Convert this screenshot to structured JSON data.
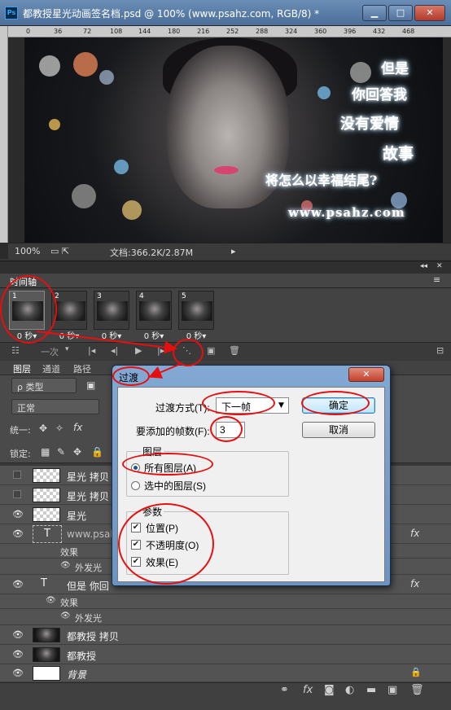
{
  "window": {
    "title": "都教授星光动画签名档.psd @ 100% (www.psahz.com, RGB/8) *",
    "ps_badge": "Ps",
    "min": "▁",
    "max": "□",
    "close": "✕"
  },
  "ruler": {
    "ticks": [
      "0",
      "36",
      "72",
      "108",
      "144",
      "180",
      "216",
      "252",
      "288",
      "324",
      "360",
      "396",
      "432",
      "468"
    ]
  },
  "canvas": {
    "poem": [
      "但是",
      "你回答我",
      "没有爱情",
      "故事",
      "将怎么以幸福结尾?"
    ],
    "watermark": "www.psahz.com"
  },
  "status": {
    "zoom": "100%",
    "doc": "文档:366.2K/2.87M"
  },
  "timeline": {
    "tab": "时间轴",
    "frames": [
      {
        "num": "1",
        "delay": "0 秒▾"
      },
      {
        "num": "2",
        "delay": "0 秒▾"
      },
      {
        "num": "3",
        "delay": "0 秒▾"
      },
      {
        "num": "4",
        "delay": "0 秒▾"
      },
      {
        "num": "5",
        "delay": "0 秒▾"
      }
    ],
    "loop": "一次"
  },
  "layers_panel": {
    "tabs": [
      "图层",
      "通道",
      "路径"
    ],
    "filter": "ρ 类型",
    "blend": "正常",
    "unify": "统一:",
    "lock": "锁定:",
    "rows": [
      {
        "name": "星光 拷贝",
        "visible": false,
        "thumb": "checker"
      },
      {
        "name": "星光 拷贝",
        "visible": false,
        "thumb": "checker"
      },
      {
        "name": "星光",
        "visible": true,
        "thumb": "checker"
      },
      {
        "name": "www.psah",
        "visible": true,
        "thumb": "text",
        "fx": "fx"
      },
      {
        "name": "效果",
        "sub": true
      },
      {
        "name": "外发光",
        "sub2": true
      },
      {
        "name": "但是 你回",
        "visible": true,
        "thumb": "text",
        "fx": "fx"
      },
      {
        "name": "效果",
        "sub": true
      },
      {
        "name": "外发光",
        "sub2": true
      },
      {
        "name": "都教授 拷贝",
        "visible": true,
        "thumb": "photo"
      },
      {
        "name": "都教授",
        "visible": true,
        "thumb": "photo"
      },
      {
        "name": "背景",
        "visible": true,
        "thumb": "white",
        "italic": true
      }
    ]
  },
  "dialog": {
    "title": "过渡",
    "method_label": "过渡方式(T):",
    "method_value": "下一帧",
    "frames_label": "要添加的帧数(F):",
    "frames_value": "3",
    "layers_group": "图层",
    "all_layers": "所有图层(A)",
    "selected_layers": "选中的图层(S)",
    "params_group": "参数",
    "position": "位置(P)",
    "opacity": "不透明度(O)",
    "effects": "效果(E)",
    "ok": "确定",
    "cancel": "取消"
  },
  "colors": {
    "annotation": "#e41010",
    "titlebar": "#5b7fab"
  }
}
